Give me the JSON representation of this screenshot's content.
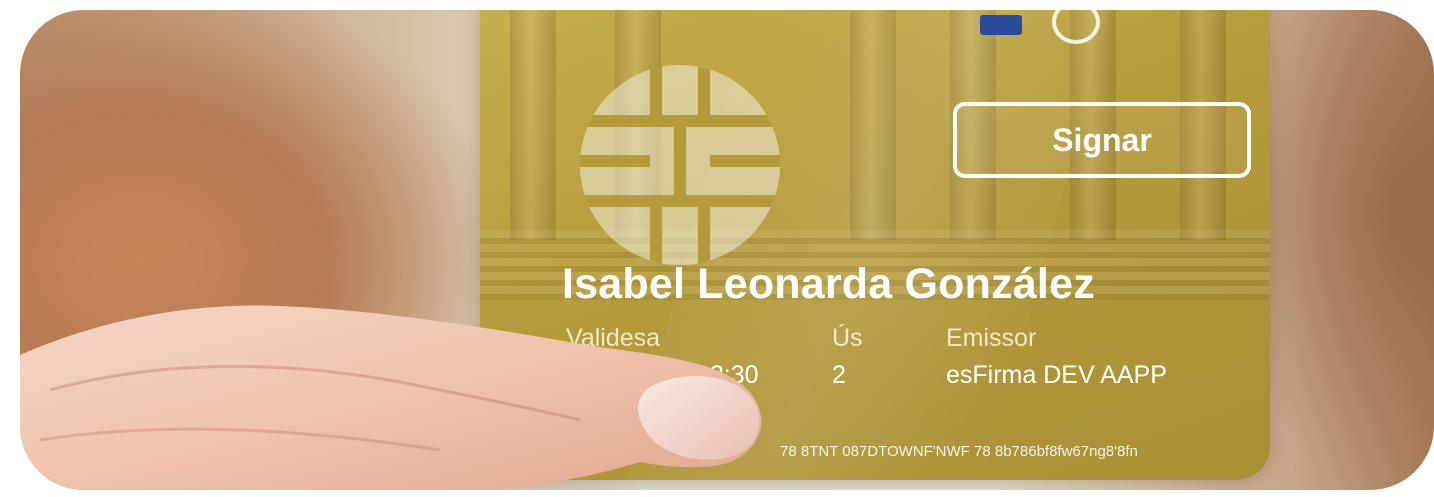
{
  "card": {
    "button_label": "Signar",
    "holder_name": "Isabel Leonarda González",
    "fields": [
      {
        "label": "Validesa",
        "value": "12:30"
      },
      {
        "label": "Ús",
        "value": "2"
      },
      {
        "label": "Emissor",
        "value": "esFirma DEV AAPP"
      }
    ],
    "serial": "78 8TNT 087DTOWNF'NWF 78 8b786bf8fw67ng8'8fn"
  },
  "colors": {
    "card_gold": "#b69b3b",
    "text": "#ffffff"
  }
}
